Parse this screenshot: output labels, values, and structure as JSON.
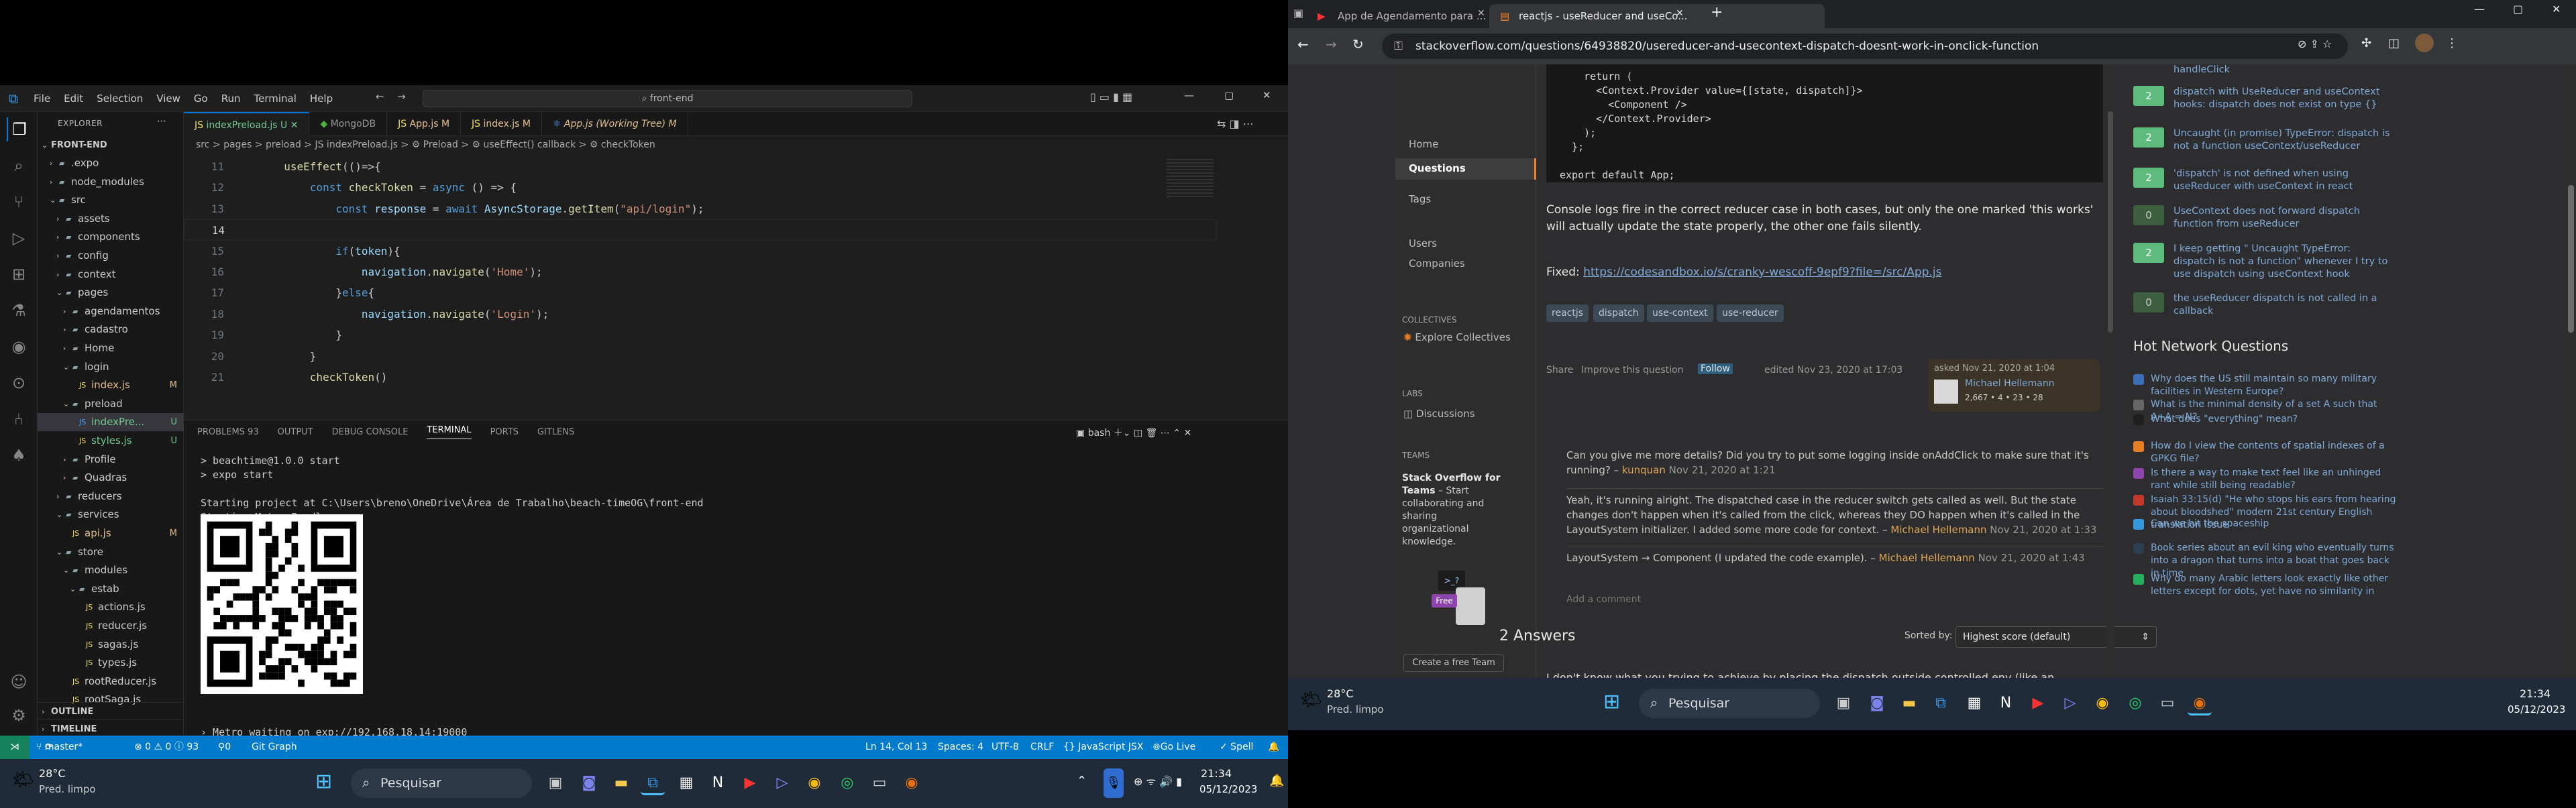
{
  "vscode": {
    "menu": [
      "File",
      "Edit",
      "Selection",
      "View",
      "Go",
      "Run",
      "Terminal",
      "Help"
    ],
    "search_text": "front-end",
    "explorer_title": "EXPLORER",
    "root": "FRONT-END",
    "tree": [
      {
        "name": ".expo",
        "badge": ""
      },
      {
        "name": "node_modules",
        "badge": ""
      },
      {
        "name": "src",
        "badge": ""
      },
      {
        "name": "assets",
        "badge": ""
      },
      {
        "name": "components",
        "badge": ""
      },
      {
        "name": "config",
        "badge": ""
      },
      {
        "name": "context",
        "badge": ""
      },
      {
        "name": "pages",
        "badge": ""
      },
      {
        "name": "agendamentos",
        "badge": ""
      },
      {
        "name": "cadastro",
        "badge": ""
      },
      {
        "name": "Home",
        "badge": ""
      },
      {
        "name": "login",
        "badge": ""
      },
      {
        "name": "index.js",
        "badge": "M"
      },
      {
        "name": "preload",
        "badge": ""
      },
      {
        "name": "indexPre...",
        "badge": "U"
      },
      {
        "name": "styles.js",
        "badge": "U"
      },
      {
        "name": "Profile",
        "badge": ""
      },
      {
        "name": "Quadras",
        "badge": ""
      },
      {
        "name": "reducers",
        "badge": ""
      },
      {
        "name": "services",
        "badge": ""
      },
      {
        "name": "api.js",
        "badge": "M"
      },
      {
        "name": "store",
        "badge": ""
      },
      {
        "name": "modules",
        "badge": ""
      },
      {
        "name": "estab",
        "badge": ""
      },
      {
        "name": "actions.js",
        "badge": ""
      },
      {
        "name": "reducer.js",
        "badge": ""
      },
      {
        "name": "sagas.js",
        "badge": ""
      },
      {
        "name": "types.js",
        "badge": ""
      },
      {
        "name": "rootReducer.js",
        "badge": ""
      },
      {
        "name": "rootSaga.js",
        "badge": ""
      }
    ],
    "outline": "OUTLINE",
    "timeline": "TIMELINE",
    "tabs": [
      "indexPreload.js U",
      "MongoDB",
      "App.js M",
      "index.js M",
      "App.js (Working Tree) M"
    ],
    "breadcrumb": "src > pages > preload > JS indexPreload.js > ⚙ Preload > ⚙ useEffect() callback > ⚙ checkToken",
    "code": [
      {
        "ln": "11",
        "text": "  useEffect(()=>{"
      },
      {
        "ln": "12",
        "text": "      const checkToken = async () => {"
      },
      {
        "ln": "13",
        "text": "          const response = await AsyncStorage.getItem(\"api/login\");"
      },
      {
        "ln": "14",
        "text": ""
      },
      {
        "ln": "15",
        "text": "          if(token){"
      },
      {
        "ln": "16",
        "text": "              navigation.navigate('Home');"
      },
      {
        "ln": "17",
        "text": "          }else{"
      },
      {
        "ln": "18",
        "text": "              navigation.navigate('Login');"
      },
      {
        "ln": "19",
        "text": "          }"
      },
      {
        "ln": "20",
        "text": "      }"
      },
      {
        "ln": "21",
        "text": "      checkToken()"
      }
    ],
    "panel_tabs": [
      "PROBLEMS 93",
      "OUTPUT",
      "DEBUG CONSOLE",
      "TERMINAL",
      "PORTS",
      "GITLENS"
    ],
    "terminal_shell": "bash",
    "terminal_top": "> beachtime@1.0.0 start\n> expo start\n\nStarting project at C:\\Users\\breno\\OneDrive\\Área de Trabalho\\beach-timeOG\\front-end\nStarting Metro Bundler",
    "terminal_bottom": "› Metro waiting on exp://192.168.18.14:19000\n› Scan the QR code above with Expo Go (Android) or the Camera app (iOS)",
    "status": {
      "branch": "master*",
      "errors": "⊗ 0 ⚠ 0 ⓘ 93",
      "ports": "0",
      "gitgraph": "Git Graph",
      "position": "Ln 14, Col 13",
      "spaces": "Spaces: 4",
      "encoding": "UTF-8",
      "eol": "CRLF",
      "lang": "{} JavaScript JSX",
      "golive": "Go Live",
      "spell": "✓ Spell"
    }
  },
  "taskbar_left": {
    "weather_temp": "28°C",
    "weather_desc": "Pred. limpo",
    "search": "Pesquisar",
    "time": "21:34",
    "date": "05/12/2023"
  },
  "chrome": {
    "tab1": "App de Agendamento para ...",
    "tab2": "reactjs - useReducer and useCo...",
    "url": "stackoverflow.com/questions/64938820/usereducer-and-usecontext-dispatch-doesnt-work-in-onclick-function",
    "code_lines": "    return (\n      <Context.Provider value={[state, dispatch]}>\n        <Component />\n      </Context.Provider>\n    );\n  };\n\nexport default App;",
    "para": "Console logs fire in the correct reducer case in both cases, but only the one marked 'this works' will actually update the state properly, the other one fails silently.",
    "fixed_label": "Fixed:",
    "fixed_link": "https://codesandbox.io/s/cranky-wescoff-9epf9?file=/src/App.js",
    "tags": [
      "reactjs",
      "dispatch",
      "use-context",
      "use-reducer"
    ],
    "share": "Share",
    "improve": "Improve this question",
    "follow": "Follow",
    "edited": "edited Nov 23, 2020 at 17:03",
    "asked": "asked Nov 21, 2020 at 1:04",
    "asker": "Michael Hellemann",
    "asker_rep": "2,667 • 4 • 23 • 28",
    "comments": [
      {
        "text": "Can you give me more details? Did you try to put some logging inside onAddClick to make sure that it's running? –",
        "user": "kunquan",
        "date": "Nov 21, 2020 at 1:21"
      },
      {
        "text": "Yeah, it's running alright. The dispatched case in the reducer switch gets called as well. But the state changes don't happen when it's called from the click, whereas they DO happen when it's called in the LayoutSystem initializer. I added some more code for context. –",
        "user": "Michael Hellemann",
        "date": "Nov 21, 2020 at 1:33"
      },
      {
        "text": "LayoutSystem → Component (I updated the code example). –",
        "user": "Michael Hellemann",
        "date": "Nov 21, 2020 at 1:43"
      }
    ],
    "add_comment": "Add a comment",
    "answers_count": "2 Answers",
    "sorted_by": "Sorted by:",
    "sort_value": "Highest score (default)",
    "answer_preview": "I don't know what you trying to achieve by placing the dispatch outside controlled env (like an",
    "leftnav": [
      "Home",
      "Questions",
      "Tags",
      "Users",
      "Companies"
    ],
    "collectives_title": "COLLECTIVES",
    "explore_collectives": "Explore Collectives",
    "labs_title": "LABS",
    "discussions": "Discussions",
    "teams_title": "TEAMS",
    "teams_promo_title": "Stack Overflow for Teams",
    "teams_promo_text": " – Start collaborating and sharing organizational knowledge.",
    "free_badge": "Free",
    "create_team": "Create a free Team",
    "related_top": "handleClick",
    "related": [
      {
        "score": "2",
        "text": "dispatch with UseReducer and useContext hooks: dispatch does not exist on type {}"
      },
      {
        "score": "2",
        "text": "Uncaught (in promise) TypeError: dispatch is not a function useContext/useReducer"
      },
      {
        "score": "2",
        "text": "'dispatch' is not defined when using useReducer with useContext in react"
      },
      {
        "score": "0",
        "text": "UseContext does not forward dispatch function from useReducer"
      },
      {
        "score": "2",
        "text": "I keep getting \" Uncaught TypeError: dispatch is not a function\" whenever I try to use dispatch using useContext hook"
      },
      {
        "score": "0",
        "text": "the useReducer dispatch is not called in a callback"
      }
    ],
    "hnq_title": "Hot Network Questions",
    "hnq": [
      "Why does the US still maintain so many military facilities in Western Europe?",
      "What is the minimal density of a set A such that A+A = N?",
      "What does \"everything\" mean?",
      "How do I view the contents of spatial indexes of a GPKG file?",
      "Is there a way to make text feel like an unhinged rant while still being readable?",
      "Isaiah 33:15(d) \"He who stops his ears from hearing about bloodshed\" modern 21st century English translation issue",
      "Can we hit the spaceship",
      "Book series about an evil king who eventually turns into a dragon that turns into a boat that goes back in time",
      "Why do many Arabic letters look exactly like other letters except for dots, yet have no similarity in"
    ]
  },
  "taskbar_right": {
    "weather_temp": "28°C",
    "weather_desc": "Pred. limpo",
    "search": "Pesquisar",
    "time": "21:34",
    "date": "05/12/2023"
  },
  "colors": {
    "accent": "#007acc",
    "so_green": "#5eba7d",
    "link": "#7fa9d6"
  }
}
